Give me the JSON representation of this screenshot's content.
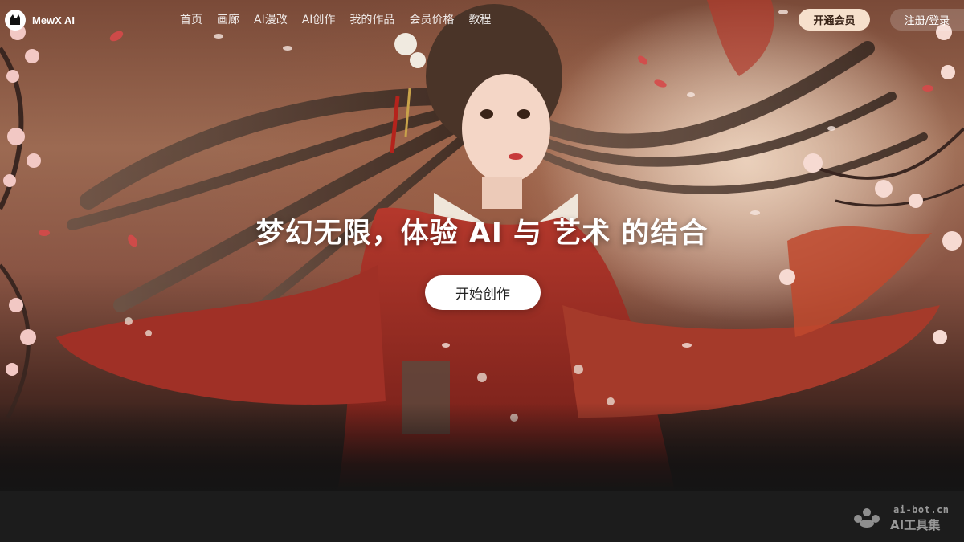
{
  "nav": {
    "logo_text": "MewX AI",
    "links": [
      {
        "label": "首页"
      },
      {
        "label": "画廊"
      },
      {
        "label": "AI漫改"
      },
      {
        "label": "AI创作"
      },
      {
        "label": "我的作品"
      },
      {
        "label": "会员价格"
      },
      {
        "label": "教程"
      }
    ],
    "vip_button": "开通会员",
    "login_button": "注册/登录"
  },
  "hero": {
    "headline": "梦幻无限，体验 AI 与 艺术 的结合",
    "cta": "开始创作"
  },
  "watermark": {
    "url": "ai-bot.cn",
    "name": "AI工具集"
  },
  "colors": {
    "vip_button_bg": "#f6e0cc",
    "footer_bg": "#1c1c1c",
    "robe_red": "#a8322a"
  }
}
